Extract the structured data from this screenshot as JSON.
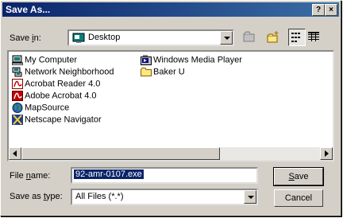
{
  "window": {
    "title": "Save As...",
    "help_glyph": "?",
    "close_glyph": "×"
  },
  "savein": {
    "label_pre": "Save ",
    "label_u": "i",
    "label_post": "n:",
    "value": "Desktop"
  },
  "toolbar": {
    "icons": [
      "up-one-level-icon",
      "create-new-folder-icon",
      "list-view-icon",
      "details-view-icon"
    ]
  },
  "files": [
    {
      "name": "My Computer",
      "icon": "computer-icon"
    },
    {
      "name": "Network Neighborhood",
      "icon": "network-icon"
    },
    {
      "name": "Acrobat Reader 4.0",
      "icon": "acrobat-icon"
    },
    {
      "name": "Adobe Acrobat 4.0",
      "icon": "acrobat-icon"
    },
    {
      "name": "MapSource",
      "icon": "globe-icon"
    },
    {
      "name": "Netscape Navigator",
      "icon": "netscape-icon"
    },
    {
      "name": "Windows Media Player",
      "icon": "media-player-icon"
    },
    {
      "name": "Baker U",
      "icon": "folder-icon"
    }
  ],
  "filename": {
    "label_pre": "File ",
    "label_u": "n",
    "label_post": "ame:",
    "value": "92-amr-0107.exe"
  },
  "savetype": {
    "label_pre": "Save as ",
    "label_u": "t",
    "label_post": "ype:",
    "value": "All Files (*.*)"
  },
  "buttons": {
    "save_u": "S",
    "save_rest": "ave",
    "cancel": "Cancel"
  },
  "colors": {
    "titlebar": "#0a246a",
    "face": "#d4d0c8"
  }
}
